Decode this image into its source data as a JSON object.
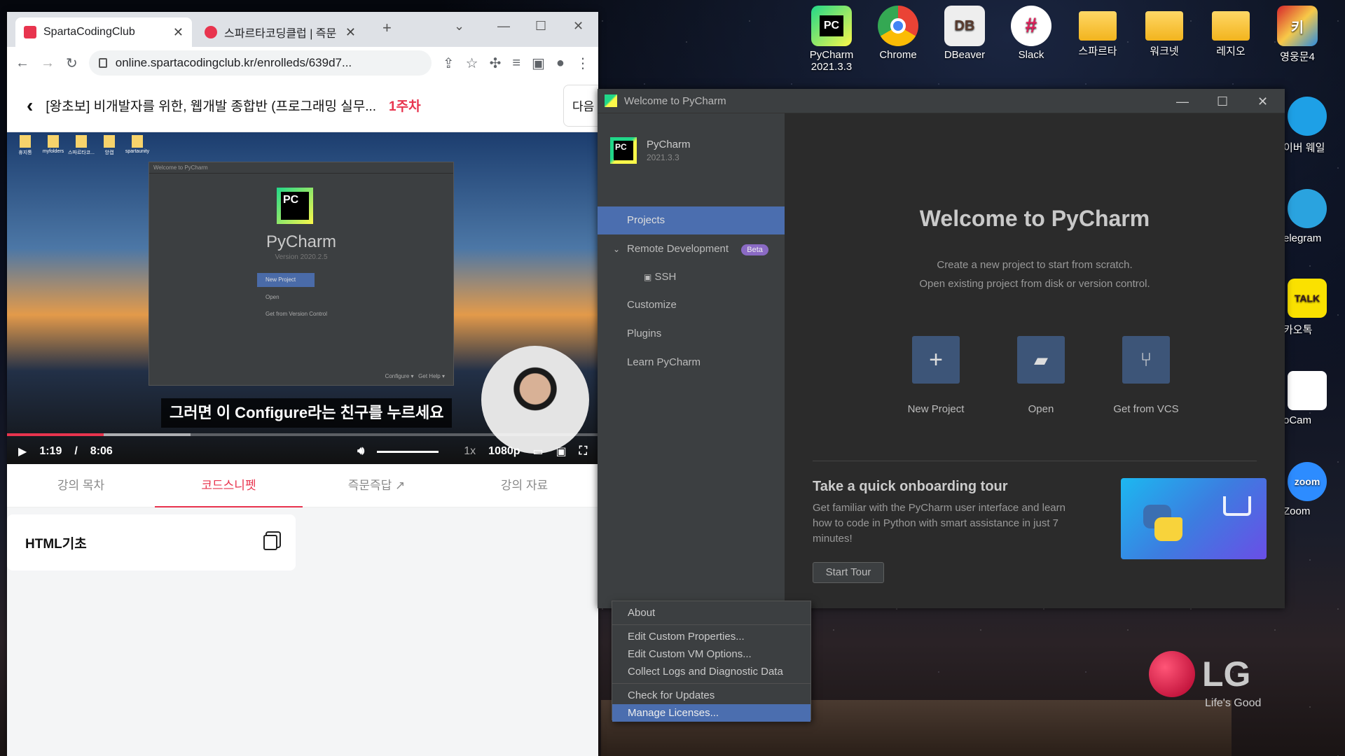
{
  "desktop": {
    "top_icons": [
      {
        "label": "PyCharm\n2021.3.3",
        "icon": "pycharm-icon",
        "color": "#21d789"
      },
      {
        "label": "Chrome",
        "icon": "chrome-icon",
        "color": "#4285f4"
      },
      {
        "label": "DBeaver",
        "icon": "dbeaver-icon",
        "color": "#eeeeee"
      },
      {
        "label": "Slack",
        "icon": "slack-icon",
        "color": "#ffffff"
      },
      {
        "label": "스파르타",
        "icon": "folder-icon",
        "color": "#f2b41d"
      },
      {
        "label": "워크넷",
        "icon": "folder-icon",
        "color": "#f2b41d"
      },
      {
        "label": "레지오",
        "icon": "folder-icon",
        "color": "#f2b41d"
      },
      {
        "label": "영웅문4",
        "icon": "youngwoongmun-icon",
        "color": "#d6242b"
      }
    ],
    "side_icons": [
      {
        "label": "이버 웨일",
        "icon": "whale-icon",
        "color": "#1ea0e6"
      },
      {
        "label": "elegram",
        "icon": "telegram-icon",
        "color": "#2aa3df"
      },
      {
        "label": "카오톡",
        "icon": "kakaotalk-icon",
        "color": "#fae100"
      },
      {
        "label": "oCam",
        "icon": "ocam-icon",
        "color": "#ffffff"
      },
      {
        "label": "Zoom",
        "icon": "zoom-icon",
        "color": "#2d8cff"
      }
    ],
    "lg_logo": {
      "brand": "LG",
      "slogan": "Life's Good"
    }
  },
  "browser": {
    "tabs": [
      {
        "title": "SpartaCodingClub",
        "active": true,
        "favicon_color": "#e8344e"
      },
      {
        "title": "스파르타코딩클럽 | 즉문",
        "active": false,
        "favicon_color": "#e8344e"
      }
    ],
    "new_tab_symbol": "+",
    "url": "online.spartacodingclub.kr/enrolleds/639d7...",
    "course": {
      "title": "[왕초보] 비개발자를 위한, 웹개발 종합반 (프로그래밍 실무...",
      "week": "1주차",
      "next_label": "다음"
    },
    "video": {
      "subtitle": "그러면 이 Configure라는 친구를 누르세요",
      "current_time": "1:19",
      "time_separator": "/",
      "duration": "8:06",
      "progress_fraction": 0.164,
      "buffered_fraction": 0.31,
      "playback_rate": "1x",
      "quality": "1080p",
      "inner_screen": {
        "window_title": "Welcome to PyCharm",
        "app_name": "PyCharm",
        "version": "Version 2020.2.5",
        "actions": [
          "New Project",
          "Open",
          "Get from Version Control"
        ],
        "footer": [
          "Configure",
          "Get Help"
        ],
        "desktop_icons": [
          "휴지통",
          "myfolders",
          "스파르타코...",
          "앙캡",
          "spartaunity"
        ]
      }
    },
    "course_tabs": [
      {
        "label": "강의 목차",
        "active": false
      },
      {
        "label": "코드스니펫",
        "active": true
      },
      {
        "label": "즉문즉답",
        "active": false,
        "external": true
      },
      {
        "label": "강의 자료",
        "active": false
      }
    ],
    "snippet": {
      "title": "HTML기초"
    }
  },
  "pycharm": {
    "window_title": "Welcome to PyCharm",
    "brand_name": "PyCharm",
    "brand_version": "2021.3.3",
    "nav": [
      {
        "label": "Projects",
        "active": true
      },
      {
        "label": "Remote Development",
        "badge": "Beta",
        "expandable": true
      },
      {
        "label": "SSH",
        "child": true
      },
      {
        "label": "Customize"
      },
      {
        "label": "Plugins"
      },
      {
        "label": "Learn PyCharm"
      }
    ],
    "welcome_title": "Welcome to PyCharm",
    "welcome_line1": "Create a new project to start from scratch.",
    "welcome_line2": "Open existing project from disk or version control.",
    "actions": [
      {
        "label": "New Project",
        "icon": "plus-icon"
      },
      {
        "label": "Open",
        "icon": "folder-open-icon"
      },
      {
        "label": "Get from VCS",
        "icon": "vcs-branch-icon"
      }
    ],
    "tour": {
      "title": "Take a quick onboarding tour",
      "description": "Get familiar with the PyCharm user interface and learn how to code in Python with smart assistance in just 7 minutes!",
      "button": "Start Tour"
    },
    "accent_color": "#4b6eaf"
  },
  "gear_menu": {
    "groups": [
      [
        "About"
      ],
      [
        "Edit Custom Properties...",
        "Edit Custom VM Options...",
        "Collect Logs and Diagnostic Data"
      ],
      [
        "Check for Updates",
        "Manage Licenses..."
      ]
    ],
    "selected": "Manage Licenses..."
  }
}
